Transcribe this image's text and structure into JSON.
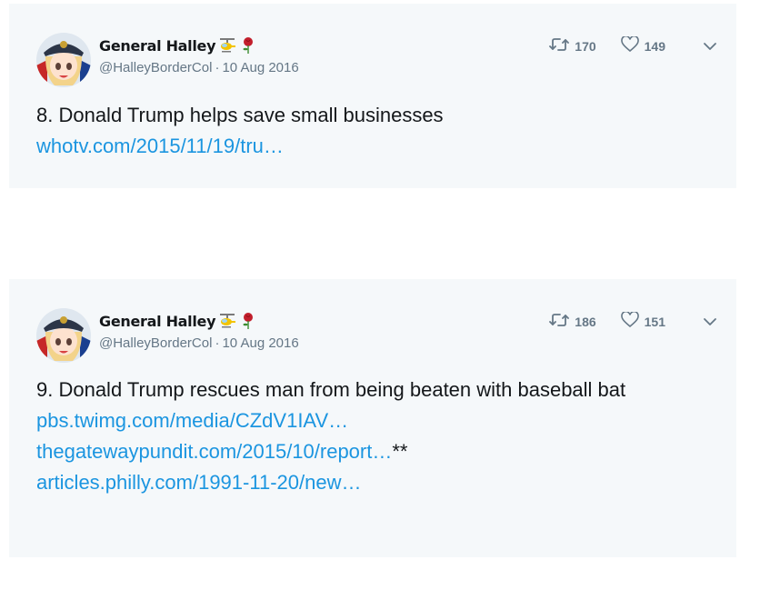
{
  "tweets": [
    {
      "author": {
        "name": "General Halley",
        "name_emojis": [
          "helicopter-emoji",
          "rose-emoji"
        ],
        "handle": "@HalleyBorderCol",
        "date": "10 Aug 2016"
      },
      "stats": {
        "retweets": "170",
        "likes": "149"
      },
      "text": "8. Donald Trump helps save small businesses",
      "links": [
        {
          "text": "whotv.com/2015/11/19/tru…",
          "suffix": ""
        }
      ]
    },
    {
      "author": {
        "name": "General Halley",
        "name_emojis": [
          "helicopter-emoji",
          "rose-emoji"
        ],
        "handle": "@HalleyBorderCol",
        "date": "10 Aug 2016"
      },
      "stats": {
        "retweets": "186",
        "likes": "151"
      },
      "text": "9. Donald Trump rescues man from being beaten with baseball bat",
      "links": [
        {
          "text": "pbs.twimg.com/media/CZdV1IAV…",
          "suffix": ""
        },
        {
          "text": "thegatewaypundit.com/2015/10/report…",
          "suffix": "**"
        },
        {
          "text": "articles.philly.com/1991-11-20/new…",
          "suffix": ""
        }
      ]
    }
  ],
  "separator": "·",
  "colors": {
    "card_bg": "#f5f8fa",
    "link": "#1b95e0",
    "muted": "#657786",
    "text": "#14171a"
  }
}
